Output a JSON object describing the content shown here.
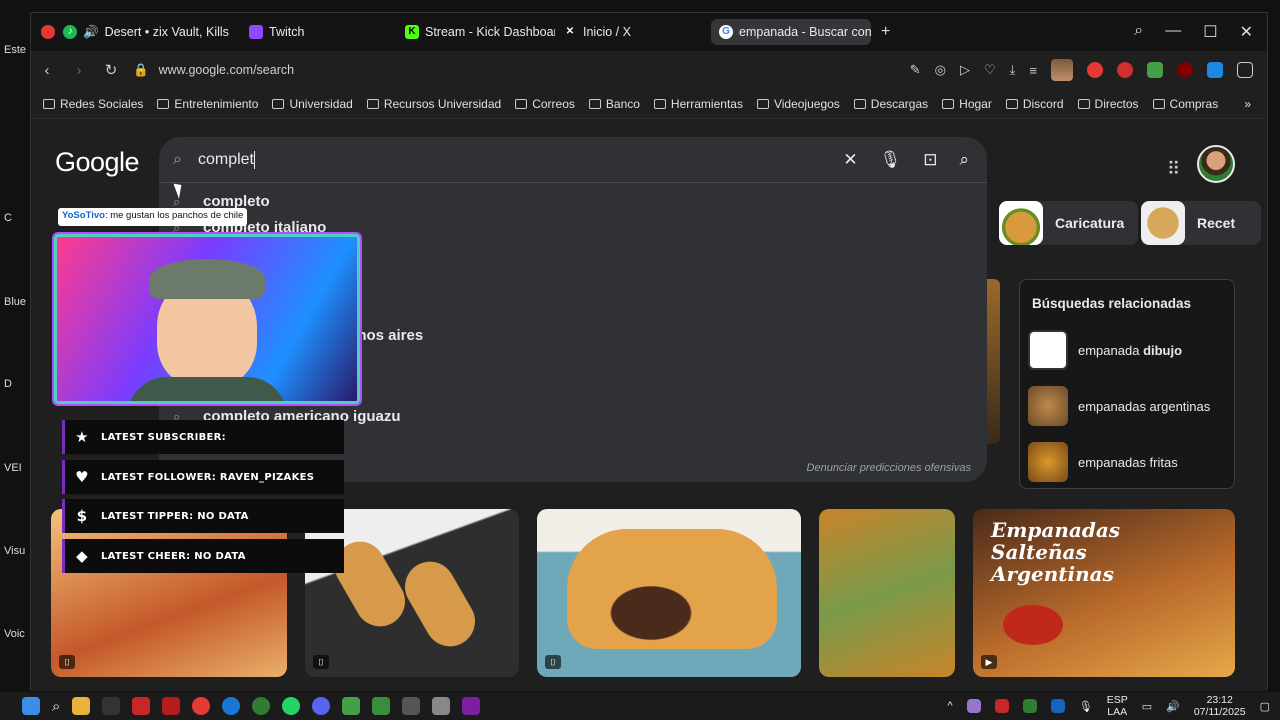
{
  "desktop": {
    "labels": [
      "Este",
      "C",
      "Blue",
      "D",
      "VEI",
      "Visu",
      "Voic"
    ]
  },
  "browser": {
    "tabs": [
      {
        "label": "Desert • zix Vault, Kills",
        "icon": "spotify-icon",
        "active": false
      },
      {
        "label": "Twitch",
        "icon": "twitch-icon",
        "active": false
      },
      {
        "label": "Stream - Kick Dashboard",
        "icon": "kick-icon",
        "active": false
      },
      {
        "label": "Inicio / X",
        "icon": "x-icon",
        "active": false
      },
      {
        "label": "empanada - Buscar con G",
        "icon": "google-icon",
        "active": true
      }
    ],
    "new_tab": "+",
    "url": "www.google.com/search",
    "bookmarks": [
      "Redes Sociales",
      "Entretenimiento",
      "Universidad",
      "Recursos Universidad",
      "Correos",
      "Banco",
      "Herramientas",
      "Videojuegos",
      "Descargas",
      "Hogar",
      "Discord",
      "Directos",
      "Compras"
    ]
  },
  "google": {
    "logo": "Google",
    "query": "complet",
    "suggestions": [
      "completo",
      "completo italiano",
      "enos aires",
      "completo americano iguazu"
    ],
    "report_text": "Denunciar predicciones ofensivas",
    "chips": [
      {
        "label": "Caricatura"
      },
      {
        "label": "Recet"
      }
    ],
    "related": {
      "title": "Búsquedas relacionadas",
      "items": [
        {
          "prefix": "empanada ",
          "bold": "dibujo"
        },
        {
          "prefix": "empanadas argentinas",
          "bold": ""
        },
        {
          "prefix": "empanadas fritas",
          "bold": ""
        }
      ]
    },
    "image_banner": "Empanadas Salteñas Argentinas"
  },
  "overlay": {
    "chat_user": "YoSoTivo",
    "chat_message": ": me gustan los panchos de chile",
    "alerts": [
      {
        "icon": "star-icon",
        "label": "Latest Subscriber:"
      },
      {
        "icon": "heart-icon",
        "label": "Latest Follower: raven_pizakes"
      },
      {
        "icon": "dollar-icon",
        "label": "Latest Tipper: No data"
      },
      {
        "icon": "diamond-icon",
        "label": "Latest Cheer: No data"
      }
    ]
  },
  "taskbar": {
    "lang_top": "ESP",
    "lang_bottom": "LAA",
    "time": "23:12",
    "date": "07/11/2025"
  },
  "colors": {
    "accent_cam_border": "#4dd0c0",
    "accent_purple": "#7b2cbf",
    "google_bg": "#1f1f1f",
    "searchbox_bg": "#303134"
  }
}
